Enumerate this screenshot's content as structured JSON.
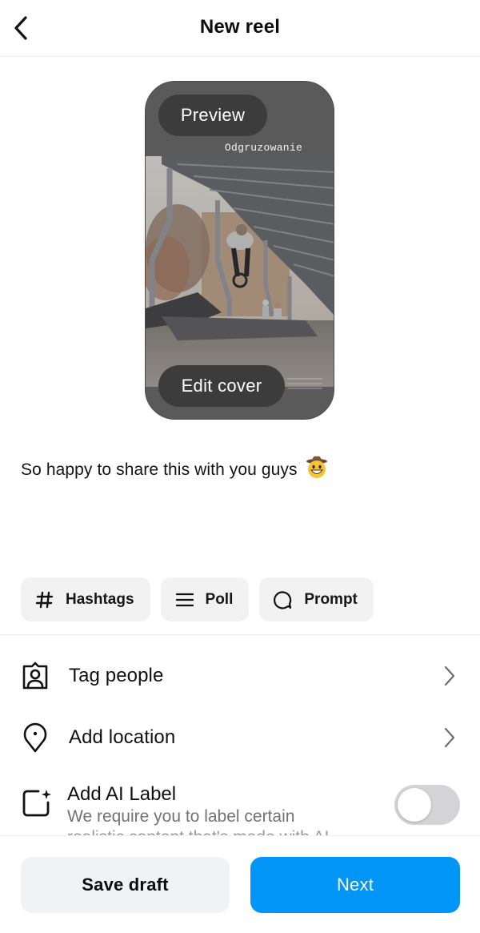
{
  "header": {
    "title": "New reel",
    "back_icon": "chevron-left-icon"
  },
  "preview": {
    "preview_label": "Preview",
    "sticker_text": "Odgruzowanie",
    "edit_cover_label": "Edit cover"
  },
  "caption": {
    "text": "So happy to share this with you guys",
    "emoji": "🤠"
  },
  "chips": [
    {
      "label": "Hashtags",
      "icon": "hashtag-icon"
    },
    {
      "label": "Poll",
      "icon": "list-icon"
    },
    {
      "label": "Prompt",
      "icon": "speech-bubble-icon"
    }
  ],
  "options": [
    {
      "label": "Tag people",
      "icon": "tag-person-icon"
    },
    {
      "label": "Add location",
      "icon": "location-pin-icon"
    }
  ],
  "ai_label": {
    "title": "Add AI Label",
    "description": "We require you to label certain",
    "description_cont": "realistic content that's made with AI",
    "toggle_on": false
  },
  "footer": {
    "save_draft_label": "Save draft",
    "next_label": "Next"
  },
  "colors": {
    "accent": "#0095f6",
    "chip_bg": "#f2f2f3",
    "toggle_off": "#d4d4d6"
  }
}
